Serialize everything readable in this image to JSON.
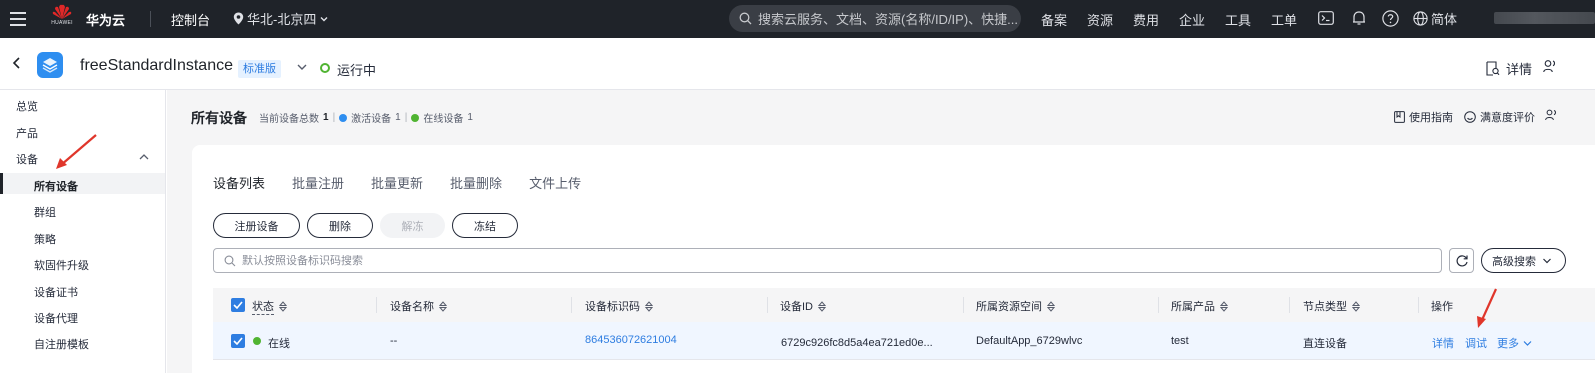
{
  "topbar": {
    "logo_text": "HUAWEI",
    "brand": "华为云",
    "console": "控制台",
    "region": "华北-北京四",
    "search_placeholder": "搜索云服务、文档、资源(名称/ID/IP)、快捷...",
    "nav": [
      "备案",
      "资源",
      "费用",
      "企业",
      "工具",
      "工单"
    ],
    "language": "简体"
  },
  "instance": {
    "name": "freeStandardInstance",
    "edition": "标准版",
    "status": "运行中",
    "detail_label": "详情"
  },
  "sidebar": {
    "items": [
      "总览",
      "产品",
      "设备"
    ],
    "sub_items": [
      "所有设备",
      "群组",
      "策略",
      "软固件升级",
      "设备证书",
      "设备代理",
      "自注册模板"
    ],
    "active": "所有设备"
  },
  "main": {
    "title": "所有设备",
    "stats": {
      "total_label": "当前设备总数",
      "total": "1",
      "active_label": "激活设备",
      "active": "1",
      "online_label": "在线设备",
      "online": "1"
    },
    "guide_label": "使用指南",
    "rating_label": "满意度评价",
    "tabs": [
      "设备列表",
      "批量注册",
      "批量更新",
      "批量删除",
      "文件上传"
    ],
    "buttons": {
      "register": "注册设备",
      "delete": "删除",
      "unfreeze": "解冻",
      "freeze": "冻结"
    },
    "search_placeholder": "默认按照设备标识码搜索",
    "advanced_search": "高级搜索"
  },
  "table": {
    "headers": [
      "状态",
      "设备名称",
      "设备标识码",
      "设备ID",
      "所属资源空间",
      "所属产品",
      "节点类型",
      "操作"
    ],
    "rows": [
      {
        "status": "在线",
        "name": "--",
        "identifier": "864536072621004",
        "device_id": "6729c926fc8d5a4ea721ed0e...",
        "space": "DefaultApp_6729wlvc",
        "product": "test",
        "node_type": "直连设备",
        "actions": [
          "详情",
          "调试",
          "更多"
        ]
      }
    ]
  },
  "colors": {
    "topbar_bg": "#1f2329",
    "accent": "#2e7de1",
    "online_green": "#50b432",
    "active_blue": "#2e8ef0",
    "annotation_red": "#e0362b"
  }
}
